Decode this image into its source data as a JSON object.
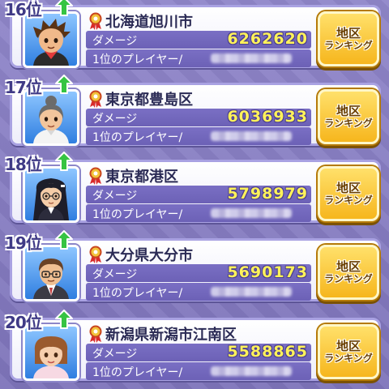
{
  "colors": {
    "background": "#857bbf",
    "card_border": "#a9a2e2",
    "stat_bar": "#7266bd",
    "damage_value": "#fff25a",
    "button": "#f6b61d",
    "rank_text": "#3f3a86"
  },
  "rows": [
    {
      "rank": "16位",
      "rank_change_icon": "green-up-arrow-icon",
      "medal_icon": "red-ribbon-medal-icon",
      "region": "北海道旭川市",
      "damage_label": "ダメージ",
      "damage": "6262620",
      "player_label": "1位のプレイヤー/",
      "button_line1": "地区",
      "button_line2": "ランキング",
      "avatar": "boy-brown-spiky-hair"
    },
    {
      "rank": "17位",
      "rank_change_icon": "green-up-arrow-icon",
      "medal_icon": "red-ribbon-medal-icon",
      "region": "東京都豊島区",
      "damage_label": "ダメージ",
      "damage": "6036933",
      "player_label": "1位のプレイヤー/",
      "button_line1": "地区",
      "button_line2": "ランキング",
      "avatar": "woman-grey-bun-hair"
    },
    {
      "rank": "18位",
      "rank_change_icon": "green-up-arrow-icon",
      "medal_icon": "red-ribbon-medal-icon",
      "region": "東京都港区",
      "damage_label": "ダメージ",
      "damage": "5798979",
      "player_label": "1位のプレイヤー/",
      "button_line1": "地区",
      "button_line2": "ランキング",
      "avatar": "girl-black-hair-glasses"
    },
    {
      "rank": "19位",
      "rank_change_icon": "green-up-arrow-icon",
      "medal_icon": "red-ribbon-medal-icon",
      "region": "大分県大分市",
      "damage_label": "ダメージ",
      "damage": "5690173",
      "player_label": "1位のプレイヤー/",
      "button_line1": "地区",
      "button_line2": "ランキング",
      "avatar": "man-brown-hair-glasses"
    },
    {
      "rank": "20位",
      "rank_change_icon": "green-up-arrow-icon",
      "medal_icon": "red-ribbon-medal-icon",
      "region": "新潟県新潟市江南区",
      "damage_label": "ダメージ",
      "damage": "5588865",
      "player_label": "1位のプレイヤー/",
      "button_line1": "地区",
      "button_line2": "ランキング",
      "avatar": "girl-brown-hair"
    }
  ]
}
